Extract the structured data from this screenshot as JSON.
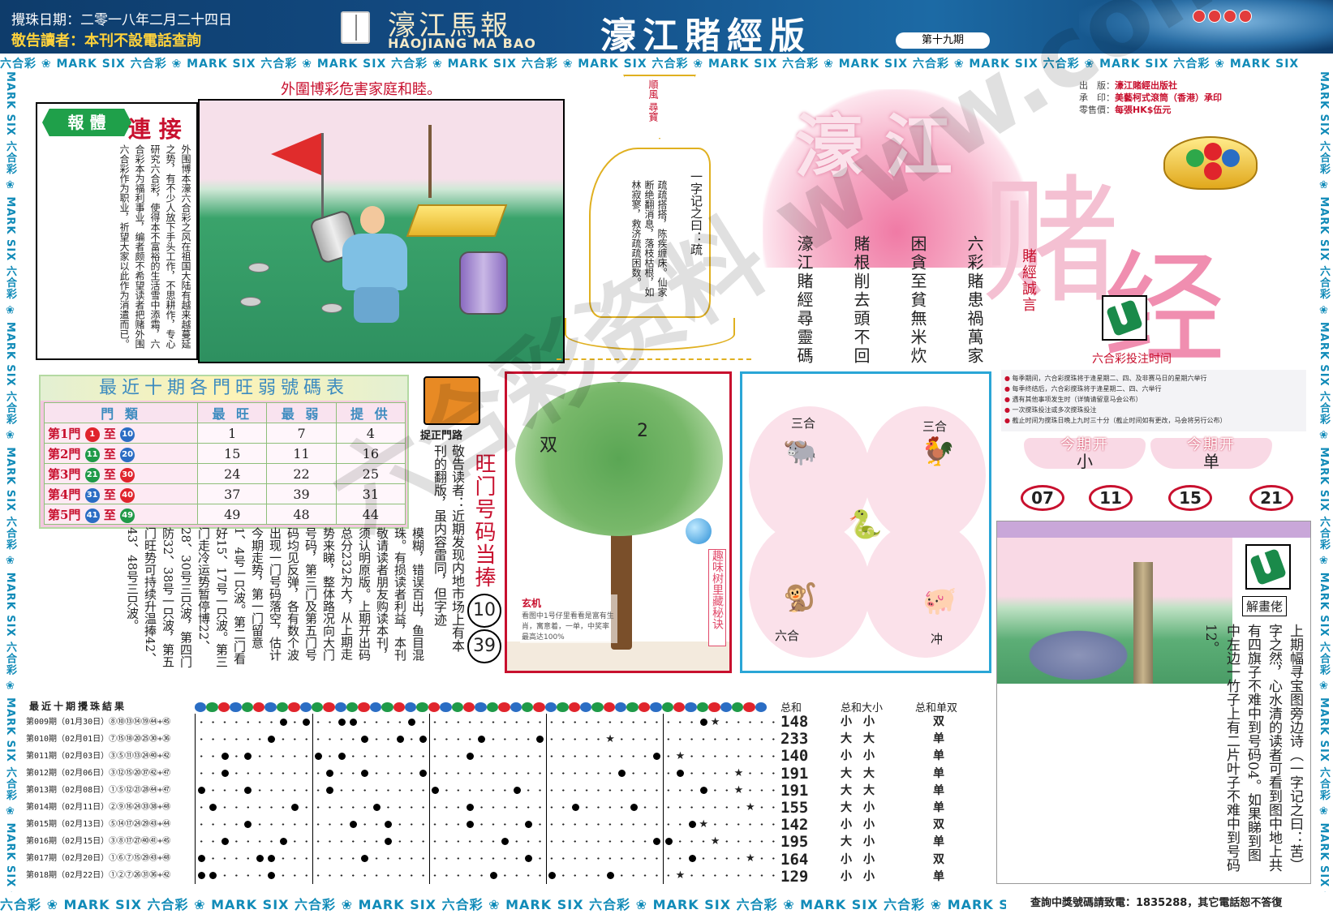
{
  "header": {
    "date": "攪珠日期：二零一八年二月二十四日",
    "warning": "敬告讀者：本刊不設電話查詢",
    "logo_cn": "濠江馬報",
    "logo_en": "HAOJIANG MA BAO",
    "title": "濠江賭經版",
    "issue": "第十九期"
  },
  "strips": {
    "horizontal": "六合彩 ❀ MARK SIX 六合彩 ❀ MARK SIX 六合彩 ❀ MARK SIX 六合彩 ❀ MARK SIX 六合彩 ❀ MARK SIX 六合彩 ❀ MARK SIX 六合彩 ❀ MARK SIX 六合彩 ❀ MARK SIX 六合彩 ❀ MARK SIX 六合彩 ❀ MARK SIX",
    "vertical": "MARK SIX 六合彩 ❀ MARK SIX 六合彩 ❀ MARK SIX 六合彩 ❀ MARK SIX 六合彩 ❀ MARK SIX 六合彩 ❀ MARK SIX 六合彩 ❀ MARK SIX 六合彩 ❀ MARK SIX 六合彩"
  },
  "headline": "外圍博彩危害家庭和睦。",
  "lianjie": {
    "badge": "報 體",
    "title": "連 接",
    "text": "外围博本濠六合彩之风在祖国大陆有越来越蔓延之势，有不少人放下手头工作，不思耕作，专心研究六合彩，使得本不富裕的生活雪中添霜，六合彩本为福利事业，编者颇不希望读者把赌外围六合彩作为职业，祈望大家以此作为消遣而已。"
  },
  "sailboat": {
    "flag_text": "順風 尋寶",
    "head": "一字记之曰：疏",
    "verse": "疏疏搭搭，陈疾缠床。仙家断绝翻消息，落枝枯根，如林寂寥，救济疏疏困数。"
  },
  "big_title": {
    "hao": "濠",
    "jiang": "江",
    "du": "赌",
    "jing": "经",
    "motto": "賭經誠言"
  },
  "publisher": {
    "l1_k": "出　版：",
    "l1_v": "濠江賭經出版社",
    "l2_k": "承　印：",
    "l2_v": "美藝柯式滾筒（香港）承印",
    "l3_k": "零售價：",
    "l3_v": "每張HK$伍元"
  },
  "poems": {
    "p1": "六彩賭患禍萬家",
    "p2": "困貪至貧無米炊",
    "p3": "賭根削去頭不回",
    "p4": "濠江賭經尋靈碼"
  },
  "hot_table": {
    "title": "最近十期各門旺弱號碼表",
    "headers": [
      "門 類",
      "最 旺",
      "最 弱",
      "提 供"
    ],
    "rows": [
      {
        "gate": "第1門",
        "from": "1",
        "to": "10",
        "fc": "b-r",
        "tc": "b-b",
        "hot": "1",
        "weak": "7",
        "give": "4"
      },
      {
        "gate": "第2門",
        "from": "11",
        "to": "20",
        "fc": "b-g",
        "tc": "b-b",
        "hot": "15",
        "weak": "11",
        "give": "16"
      },
      {
        "gate": "第3門",
        "from": "21",
        "to": "30",
        "fc": "b-g",
        "tc": "b-r",
        "hot": "24",
        "weak": "22",
        "give": "25"
      },
      {
        "gate": "第4門",
        "from": "31",
        "to": "40",
        "fc": "b-b",
        "tc": "b-r",
        "hot": "37",
        "weak": "39",
        "give": "31"
      },
      {
        "gate": "第5門",
        "from": "41",
        "to": "49",
        "fc": "b-b",
        "tc": "b-g",
        "hot": "49",
        "weak": "48",
        "give": "44"
      }
    ]
  },
  "zhengmen": {
    "label": "捉正門路",
    "notice": "敬告读者：近期发现内地市场上有本刊的翻版，虽内容雷同，但字迹",
    "long_text": "模糊，错误百出，鱼目混珠。有损读者利益，本刊敬请读者朋友购读本刊，须认明原版。上期开出码总分232为大，从上期走势来睇，整体路况向大门号码，第三门及第五门号码均见反弹，各有数个波出现一门号码落空，估计今期走势，第一门留意1、4号一只波。第二门看好15、17号一只波。第三门走冷运势暂停博22、28、30号三只波，第四门防32、38号一只波，第五门旺势可持续升温捧42、43、48号三只波。"
  },
  "wangmen": {
    "title": "旺门号码当捧",
    "n1": "10",
    "n2": "39"
  },
  "tree": {
    "shuang": "双",
    "two": "2",
    "side": "趣味树里藏秘诀",
    "card_title": "玄机",
    "card_text": "看图中1号仔里看看是富有生肖，寓意着，一单，中奖率最高达100%"
  },
  "zodiac": {
    "tl": "三合",
    "tr": "三合",
    "bl": "六合",
    "br": "冲",
    "a_tl": "🐃",
    "a_tr": "🐓",
    "a_c": "🐍",
    "a_bl": "🐒",
    "a_br": "🐖"
  },
  "times": {
    "title": "六合彩投注时间",
    "lines": [
      "每季期间，六合彩搅珠将于逢星期二、四、及非赛马日的星期六举行",
      "每季终结后，六合彩搅珠将于逢星期二、四、六举行",
      "遇有其他事项发生时（详情请留意马会公布）",
      "一次搅珠投注或多次搅珠投注",
      "截止时间为搅珠日晚上九时三十分（截止时间如有更改，马会将另行公布）"
    ],
    "open1_t": "今期开",
    "open1_v": "小",
    "open2_t": "今期开",
    "open2_v": "单",
    "nums": [
      "07",
      "11",
      "15",
      "21"
    ]
  },
  "treasure": {
    "label": "解畫佬",
    "text": "上期幅寻宝图旁边诗（一字记之曰：苦）字之然，心水清的读者可看到图中地上共有四旗子不难中到号码04。如果睇到图中左边一竹子上有二片叶子不难中到号码12。"
  },
  "results": {
    "title": "最近十期攪珠結果",
    "rows": [
      "第009期（01月30日）⑧⑩⑬⑭⑲㊹+㊺",
      "第010期（02月01日）⑦⑮⑱⑳㉕㉚+㊱",
      "第011期（02月03日）③⑤⑪⑬㉔㊵+㊷",
      "第012期（02月06日）③⑫⑮⑳㊲㊷+㊼",
      "第013期（02月08日）①⑤⑫㉑㉘㊹+㊼",
      "第014期（02月11日）②⑨⑯㉔㉝㊳+㊽",
      "第015期（02月13日）⑤⑭⑰㉔㉙㊸+㊹",
      "第016期（02月15日）③⑧⑰㉗㊵㊶+㊺",
      "第017期（02月20日）①⑥⑦⑮㉙㊸+㊽",
      "第018期（02月22日）①②⑦㉖㉛㊱+㊷"
    ],
    "sum_h": "总和",
    "sz_h": "总和大小",
    "oe_h": "总和单双",
    "sums": [
      "148",
      "233",
      "140",
      "191",
      "191",
      "155",
      "142",
      "195",
      "164",
      "129"
    ],
    "sizes": [
      "小　小",
      "大　大",
      "小　小",
      "大　大",
      "大　大",
      "大　小",
      "小　小",
      "大　小",
      "小　小",
      "小　小"
    ],
    "oe": [
      "双",
      "单",
      "单",
      "单",
      "单",
      "单",
      "双",
      "单",
      "双",
      "单"
    ]
  },
  "footer": {
    "query": "查詢中獎號碼請致電：1835288，其它電話恕不答復"
  },
  "watermark": "六合彩资料 www.com"
}
